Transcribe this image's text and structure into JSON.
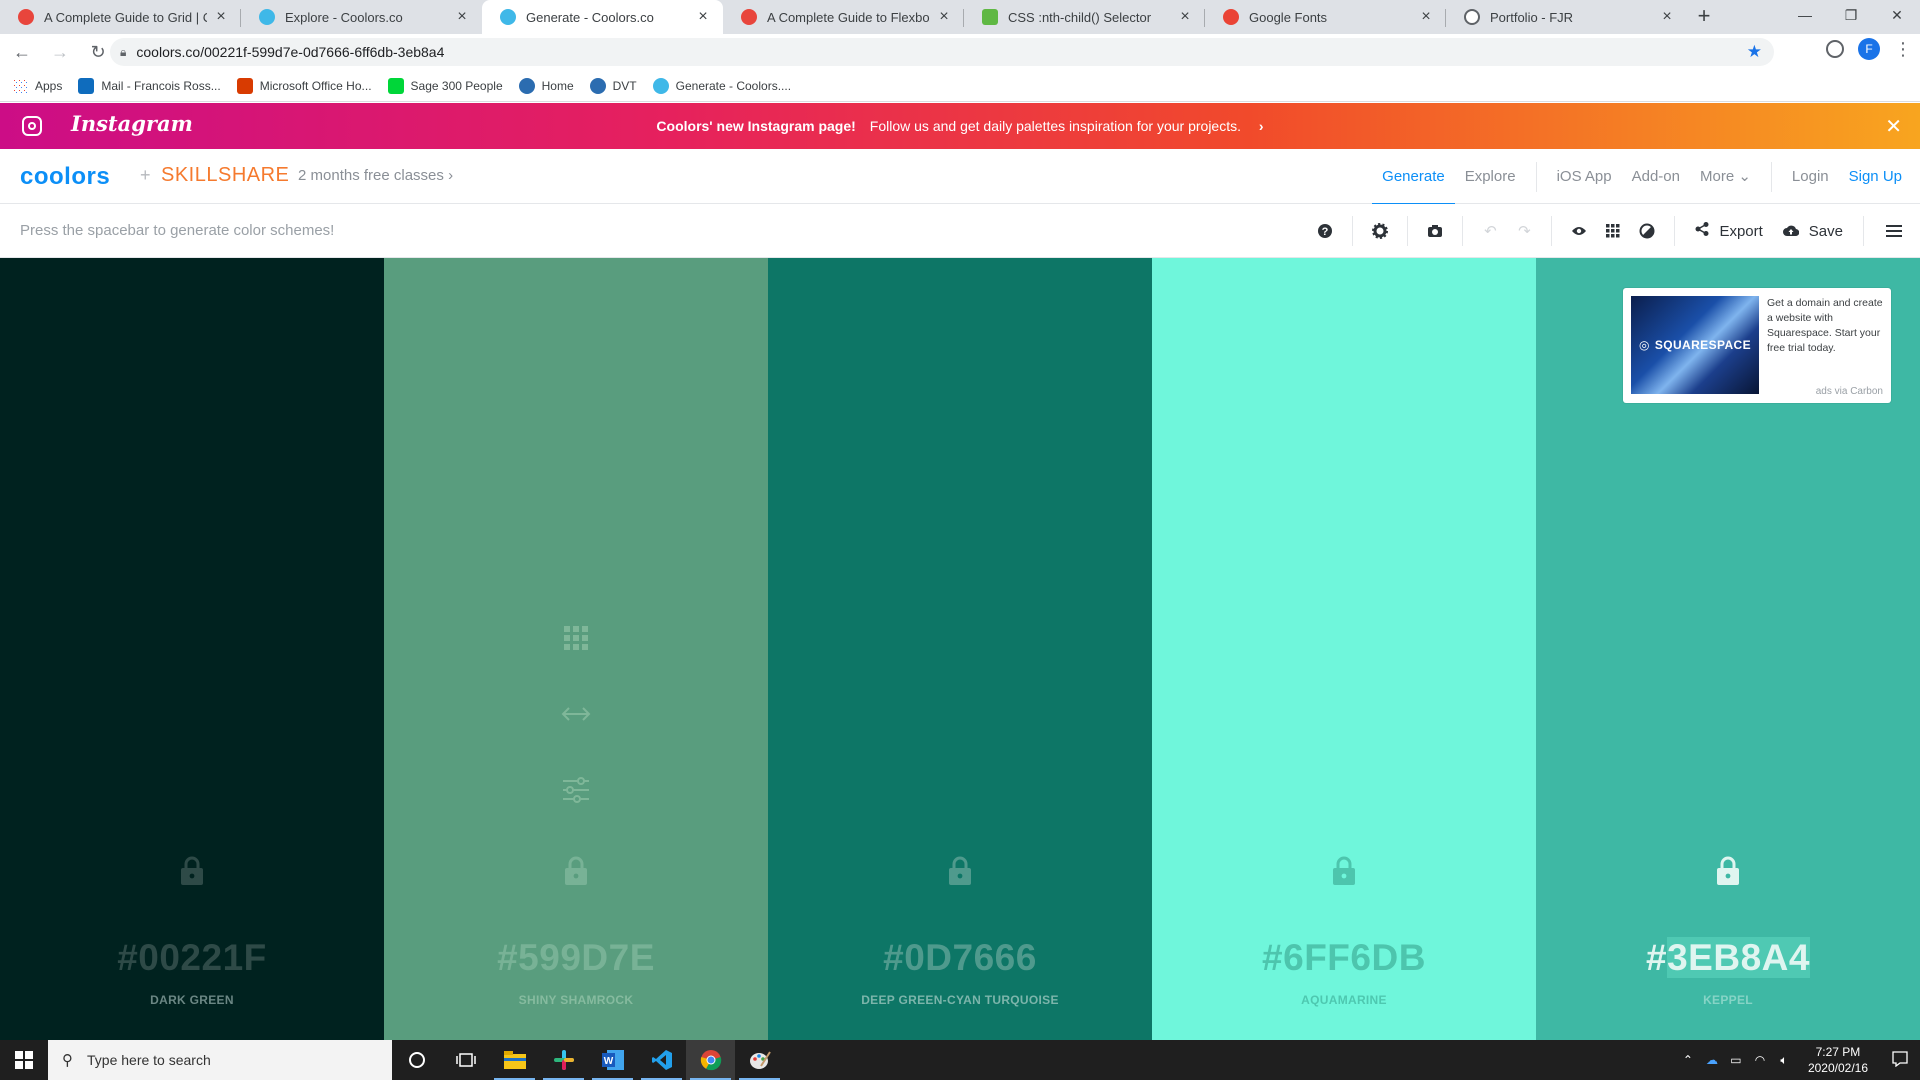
{
  "browser": {
    "tabs": [
      {
        "title": "A Complete Guide to Grid | CSS-Tricks",
        "favicon_color": "#e8453c"
      },
      {
        "title": "Explore - Coolors.co",
        "favicon_color": "#3fb8e8"
      },
      {
        "title": "Generate - Coolors.co",
        "favicon_color": "#3fb8e8"
      },
      {
        "title": "A Complete Guide to Flexbox | CSS-Tricks",
        "favicon_color": "#e8453c"
      },
      {
        "title": "CSS :nth-child() Selector",
        "favicon_color": "#5fb843"
      },
      {
        "title": "Google Fonts",
        "favicon_color": "#ea4335"
      },
      {
        "title": "Portfolio - FJR",
        "favicon_color": "#5f6368"
      }
    ],
    "active_tab": 2,
    "url": "coolors.co/00221f-599d7e-0d7666-6ff6db-3eb8a4",
    "profile_initial": "F",
    "bookmarks": [
      {
        "label": "Apps",
        "color": "#ea4335"
      },
      {
        "label": "Mail - Francois Ross...",
        "color": "#0f6cbd"
      },
      {
        "label": "Microsoft Office Ho...",
        "color": "#d83b01"
      },
      {
        "label": "Sage 300 People",
        "color": "#00d639"
      },
      {
        "label": "Home",
        "color": "#2b6cb0"
      },
      {
        "label": "DVT",
        "color": "#2b6cb0"
      },
      {
        "label": "Generate - Coolors....",
        "color": "#3fb8e8"
      }
    ]
  },
  "promo": {
    "brand": "Instagram",
    "headline": "Coolors' new Instagram page!",
    "text": "Follow us and get daily palettes inspiration for your projects.",
    "close": "✕"
  },
  "navbar": {
    "brand": "coolors",
    "plus": "+",
    "partner": "SKILLSHARE",
    "partner_promo": "2 months free classes",
    "links": [
      "Generate",
      "Explore",
      "iOS App",
      "Add-on",
      "More"
    ],
    "login": "Login",
    "signup": "Sign Up"
  },
  "toolbar": {
    "hint": "Press the spacebar to generate color schemes!",
    "export": "Export",
    "save": "Save"
  },
  "palette": [
    {
      "hex": "#00221F",
      "name": "DARK GREEN",
      "color": "#00221f",
      "text_color": "#2e4a47",
      "name_color": "#6b8784"
    },
    {
      "hex": "#599D7E",
      "name": "SHINY SHAMROCK",
      "color": "#599d7e",
      "text_color": "#78b296",
      "name_color": "#86bb9f"
    },
    {
      "hex": "#0D7666",
      "name": "DEEP GREEN-CYAN TURQUOISE",
      "color": "#0d7666",
      "text_color": "#4f9a8d",
      "name_color": "#7cb5ab"
    },
    {
      "hex": "#6FF6DB",
      "name": "AQUAMARINE",
      "color": "#6ff6db",
      "text_color": "#4dc5ad",
      "name_color": "#4ec8b0"
    },
    {
      "hex": "#3EB8A4",
      "name": "KEPPEL",
      "color": "#3eb8a4",
      "text_color": "#dff5f0",
      "name_color": "#86d4c6"
    }
  ],
  "ad": {
    "brand": "SQUARESPACE",
    "text": "Get a domain and create a website with Squarespace. Start your free trial today.",
    "via": "ads via Carbon"
  },
  "taskbar": {
    "search_placeholder": "Type here to search",
    "time": "7:27 PM",
    "date": "2020/02/16"
  }
}
